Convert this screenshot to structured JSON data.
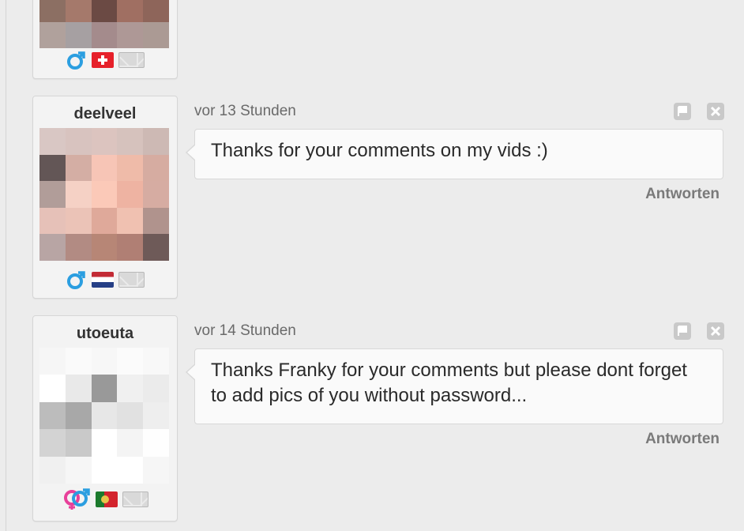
{
  "icon_names": {
    "male": "male-symbol-icon",
    "couple": "male-female-symbol-icon",
    "mail": "envelope-icon",
    "report": "flag-report-icon",
    "close": "close-x-icon"
  },
  "colors": {
    "male_symbol": "#2b9ee0",
    "female_symbol": "#e8409a",
    "reply_text": "#7a7a7a",
    "timestamp_text": "#6a6a6a"
  },
  "top_card": {
    "flag": "Switzerland"
  },
  "posts": [
    {
      "username": "deelveel",
      "country": "Netherlands",
      "timestamp": "vor 13 Stunden",
      "message": "Thanks for your comments on my vids :)",
      "reply_label": "Antworten"
    },
    {
      "username": "utoeuta",
      "country": "Portugal",
      "timestamp": "vor 14 Stunden",
      "message": "Thanks Franky for your comments but please dont forget to add pics of you without password...",
      "reply_label": "Antworten"
    }
  ]
}
